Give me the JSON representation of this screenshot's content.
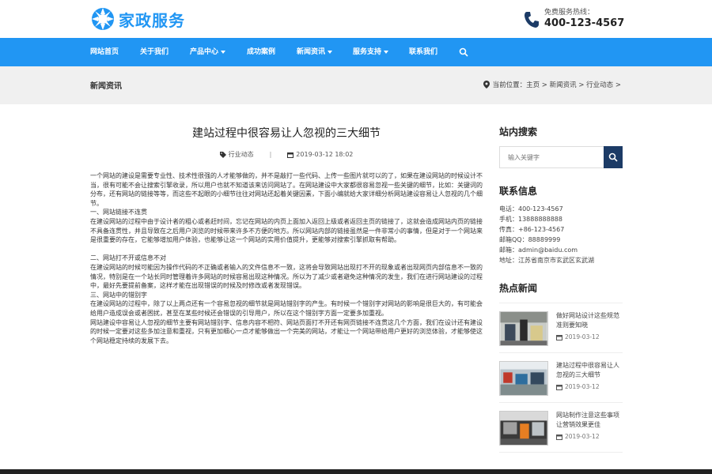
{
  "header": {
    "logo_text": "家政服务",
    "hotline_label": "免费服务热线：",
    "hotline_number": "400-123-4567"
  },
  "nav": {
    "items": [
      {
        "label": "网站首页"
      },
      {
        "label": "关于我们"
      },
      {
        "label": "产品中心",
        "dropdown": true
      },
      {
        "label": "成功案例"
      },
      {
        "label": "新闻资讯",
        "dropdown": true
      },
      {
        "label": "服务支持",
        "dropdown": true
      },
      {
        "label": "联系我们"
      }
    ]
  },
  "banner": {
    "title": "新闻资讯",
    "breadcrumb": "当前位置：主页 > 新闻资讯 > 行业动态 >"
  },
  "article": {
    "title": "建站过程中很容易让人忽视的三大细节",
    "category": "行业动态",
    "date": "2019-03-12 18:02",
    "paragraphs": [
      "一个网站的建设是需要专业性、技术性很强的人才能够做的，并不是敲打一些代码、上传一些图片就可以的了，如果在建设网站的时候设计不当，很有可能不会让搜索引擎收录，所以用户也就不知道该来访问网站了。在网站建设中大家都很容易忽视一些关键的细节，比如：关键词的分布，还有网站的链接等等，而这些不起眼的小细节往往对网站还起着关键因素，下面小编就给大家详细分析网站建设容易让人忽视的几个细节。",
      "一、网站链接不连贯",
      "在建设网站的过程中由于设计者的粗心或者赶时间，忘记在网站的内页上面加入返回上级或者返回主页的链接了，这就会造成网站内页的链接不具备连贯性，并且导致在之后用户浏览的时候带来许多不方便的地方。所以网站内部的链接虽然是一件非常小的事情，但是对于一个网站来是很重要的存在，它能够增加用户体验，也能够让这一个网站的实用价值提升，更能够对搜索引擎抓取有帮助。",
      " ",
      "二、网站打不开或信息不对",
      "在建设网站的时候可能因为操作代码的不正确或者输入的文件信息不一致，这将会导致网站出现打不开的现象或者出现网页内部信息不一致的情况，特别是在一个站长同时管理着许多网站的时候容易出现这种情况。所以为了减少或者避免这种情况的发生，我们在进行网站建设的过程中，最好先要提前备案，这样才能在出现错误的时候及时修改或者发现错误。",
      "三、网站中的错别字",
      "在建设网站的过程中，除了以上两点还有一个容易忽视的细节就是网站错别字的产生。有时候一个错别字对网站的影响是很巨大的，有可能会给用户造成误会或者困扰，甚至在某些时候还会错误的引导用户，所以在这个错别字方面一定要多加重视。",
      "网站建设中容易让人忽视的细节主要有网站错别字、信息内容不相符、网站页面打不开还有网页链接不连贯这几个方面，我们在设计还有建设的时候一定要对这些多加注意和重视，只有更加细心一点才能够做出一个完美的网站，才能让一个网站带给用户更好的浏览体验，才能够使这个网站稳定持续的发展下去。"
    ]
  },
  "sidebar": {
    "search_heading": "站内搜索",
    "search_placeholder": "输入关键字",
    "contact_heading": "联系信息",
    "contact_lines": [
      "电话：400-123-4567",
      "手机：13888888888",
      "传真：+86-123-4567",
      "邮箱QQ：88889999",
      "邮箱：admin@baidu.com",
      "地址：江苏省南京市玄武区玄武湖"
    ],
    "hot_heading": "热点新闻",
    "hot_news": [
      {
        "title": "做好网站设计这些规范准则要知晓",
        "date": "2019-03-12"
      },
      {
        "title": "建站过程中很容易让人忽视的三大细节",
        "date": "2019-03-12"
      },
      {
        "title": "网站制作注意这些事项让营销效果更佳",
        "date": "2019-03-12"
      }
    ]
  },
  "colors": {
    "accent": "#2196f3",
    "search_button": "#1c3b66",
    "banner_bg": "#f0f0f0"
  }
}
